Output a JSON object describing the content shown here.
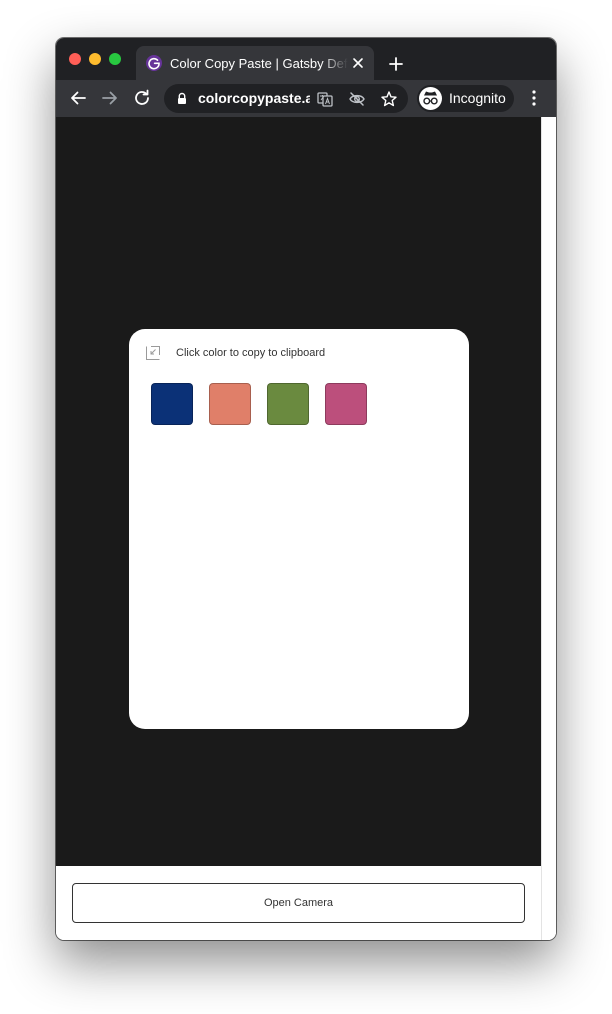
{
  "browser": {
    "tab": {
      "title": "Color Copy Paste | Gatsby Default Starter",
      "favicon": "gatsby-icon"
    },
    "address": {
      "url": "colorcopypaste.app"
    },
    "profile": {
      "label": "Incognito"
    }
  },
  "card": {
    "hint": "Click color to copy to clipboard",
    "swatches": [
      {
        "color": "#0b3177"
      },
      {
        "color": "#e07f69"
      },
      {
        "color": "#6a8a3f"
      },
      {
        "color": "#bc4f7c"
      }
    ]
  },
  "actions": {
    "open_camera_label": "Open Camera"
  },
  "theme": {
    "camera_background": "#1a1a1a",
    "chrome_frame": "#202124",
    "chrome_toolbar": "#35363a"
  }
}
